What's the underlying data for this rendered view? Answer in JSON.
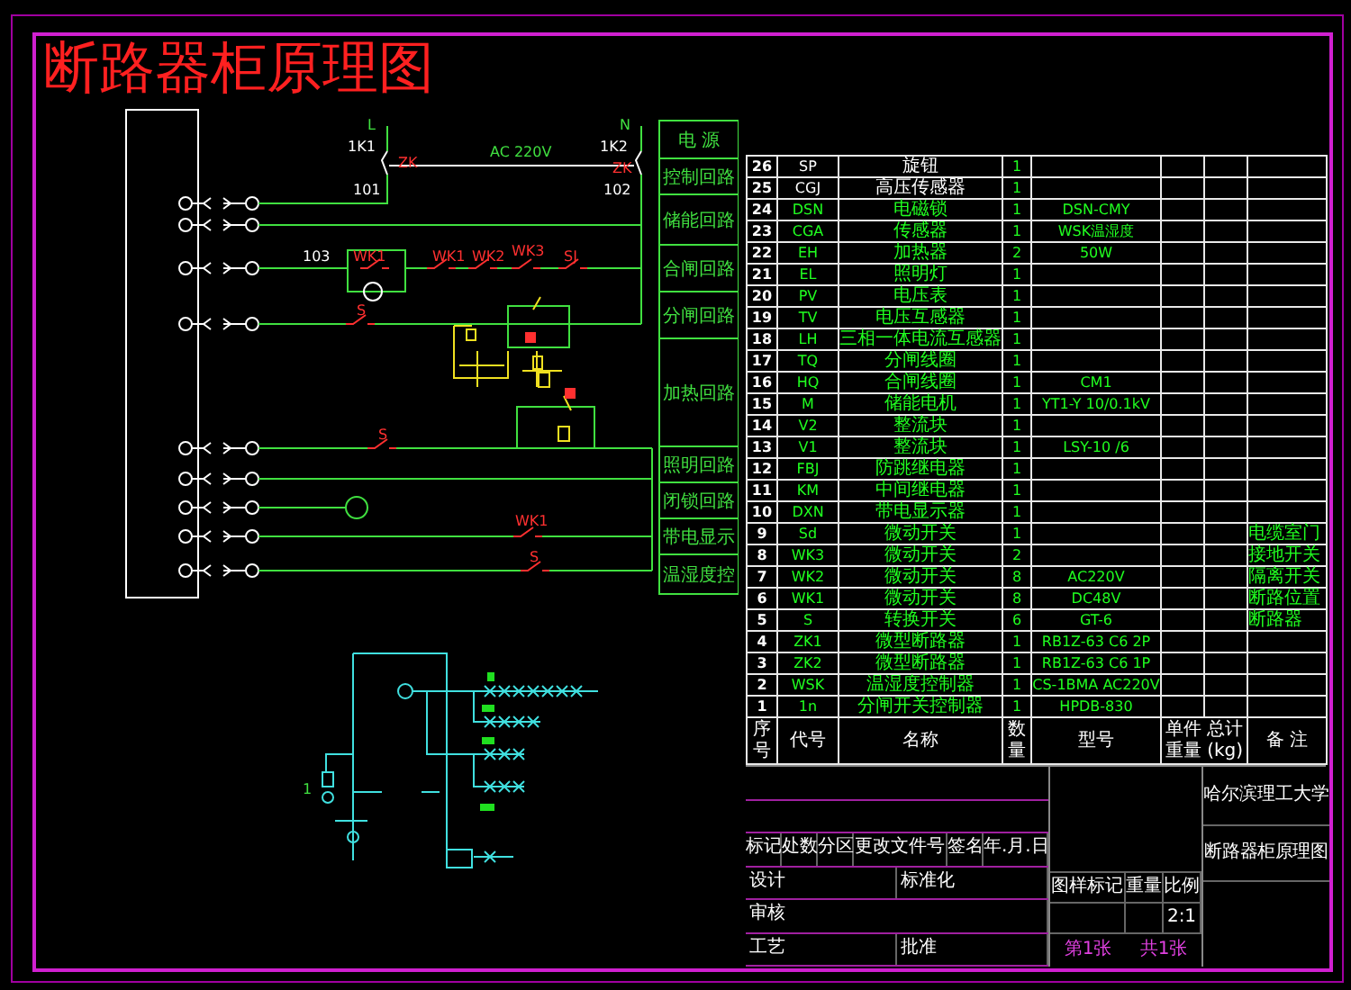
{
  "title": "断路器柜原理图",
  "schematic": {
    "labels": [
      {
        "text": "L",
        "color": "#40e040"
      },
      {
        "text": "N",
        "color": "#40e040"
      },
      {
        "text": "1K1",
        "color": "#ffffff"
      },
      {
        "text": "AC 220V",
        "color": "#40e040"
      },
      {
        "text": "1K2",
        "color": "#ffffff"
      },
      {
        "text": "ZK",
        "color": "#ff3030"
      },
      {
        "text": "ZK",
        "color": "#ff3030"
      },
      {
        "text": "101",
        "color": "#ffffff"
      },
      {
        "text": "102",
        "color": "#ffffff"
      },
      {
        "text": "103",
        "color": "#ffffff"
      },
      {
        "text": "WK1",
        "color": "#ff3030"
      },
      {
        "text": "WK1",
        "color": "#ff3030"
      },
      {
        "text": "WK2",
        "color": "#ff3030"
      },
      {
        "text": "WK3",
        "color": "#ff3030"
      },
      {
        "text": "SJ",
        "color": "#ff3030"
      },
      {
        "text": "S",
        "color": "#ff3030"
      },
      {
        "text": "S",
        "color": "#ff3030"
      },
      {
        "text": "WK1",
        "color": "#ff3030"
      },
      {
        "text": "S",
        "color": "#ff3030"
      },
      {
        "text": "1",
        "color": "#40e040"
      }
    ],
    "circuit_boxes": [
      "电 源",
      "控制回路",
      "储能回路",
      "合闸回路",
      "分闸回路",
      "加热回路",
      "照明回路",
      "闭锁回路",
      "带电显示",
      "温湿度控"
    ]
  },
  "parts_table": {
    "columns": [
      "序号",
      "代号",
      "名称",
      "数量",
      "型号"
    ],
    "weight_header": [
      "单件 总计",
      "重量 (kg)"
    ],
    "remark_header": "备 注",
    "rows": [
      {
        "no": "26",
        "code": "SP",
        "name": "旋钮",
        "qty": "1",
        "color": "#ffffff"
      },
      {
        "no": "25",
        "code": "CGJ",
        "name": "高压传感器",
        "qty": "1",
        "color": "#ffffff"
      },
      {
        "no": "24",
        "code": "DSN",
        "name": "电磁锁",
        "qty": "1",
        "model": "DSN-CMY",
        "color": "#20ff20"
      },
      {
        "no": "23",
        "code": "CGA",
        "name": "传感器",
        "qty": "1",
        "model": "WSK温湿度",
        "color": "#20ff20"
      },
      {
        "no": "22",
        "code": "EH",
        "name": "加热器",
        "qty": "2",
        "model": "50W",
        "color": "#20ff20"
      },
      {
        "no": "21",
        "code": "EL",
        "name": "照明灯",
        "qty": "1",
        "color": "#20ff20"
      },
      {
        "no": "20",
        "code": "PV",
        "name": "电压表",
        "qty": "1",
        "color": "#20ff20"
      },
      {
        "no": "19",
        "code": "TV",
        "name": "电压互感器",
        "qty": "1",
        "color": "#20ff20"
      },
      {
        "no": "18",
        "code": "LH",
        "name": "三相一体电流互感器",
        "qty": "1",
        "color": "#20ff20"
      },
      {
        "no": "17",
        "code": "TQ",
        "name": "分闸线圈",
        "qty": "1",
        "color": "#20ff20"
      },
      {
        "no": "16",
        "code": "HQ",
        "name": "合闸线圈",
        "qty": "1",
        "model": "CM1",
        "color": "#20ff20"
      },
      {
        "no": "15",
        "code": "M",
        "name": "储能电机",
        "qty": "1",
        "model": "YT1-Y 10/0.1kV",
        "color": "#20ff20"
      },
      {
        "no": "14",
        "code": "V2",
        "name": "整流块",
        "qty": "1",
        "color": "#20ff20"
      },
      {
        "no": "13",
        "code": "V1",
        "name": "整流块",
        "qty": "1",
        "model": "LSY-10 /6",
        "color": "#20ff20"
      },
      {
        "no": "12",
        "code": "FBJ",
        "name": "防跳继电器",
        "qty": "1",
        "color": "#20ff20"
      },
      {
        "no": "11",
        "code": "KM",
        "name": "中间继电器",
        "qty": "1",
        "color": "#20ff20"
      },
      {
        "no": "10",
        "code": "DXN",
        "name": "带电显示器",
        "qty": "1",
        "color": "#20ff20"
      },
      {
        "no": "9",
        "code": "Sd",
        "name": "微动开关",
        "qty": "1",
        "remark": "电缆室门",
        "color": "#20ff20"
      },
      {
        "no": "8",
        "code": "WK3",
        "name": "微动开关",
        "qty": "2",
        "remark": "接地开关",
        "color": "#20ff20"
      },
      {
        "no": "7",
        "code": "WK2",
        "name": "微动开关",
        "qty": "8",
        "model": "AC220V",
        "remark": "隔离开关",
        "color": "#20ff20"
      },
      {
        "no": "6",
        "code": "WK1",
        "name": "微动开关",
        "qty": "8",
        "model": "DC48V",
        "remark": "断路位置",
        "color": "#20ff20"
      },
      {
        "no": "5",
        "code": "S",
        "name": "转换开关",
        "qty": "6",
        "model": "GT-6",
        "remark": "断路器",
        "color": "#20ff20"
      },
      {
        "no": "4",
        "code": "ZK1",
        "name": "微型断路器",
        "qty": "1",
        "model": "RB1Z-63 C6 2P",
        "color": "#20ff20"
      },
      {
        "no": "3",
        "code": "ZK2",
        "name": "微型断路器",
        "qty": "1",
        "model": "RB1Z-63 C6 1P",
        "color": "#20ff20"
      },
      {
        "no": "2",
        "code": "WSK",
        "name": "温湿度控制器",
        "qty": "1",
        "model": "CS-1BMA AC220V",
        "color": "#20ff20"
      },
      {
        "no": "1",
        "code": "1n",
        "name": "分闸开关控制器",
        "qty": "1",
        "model": "HPDB-830",
        "color": "#20ff20"
      }
    ]
  },
  "title_block": {
    "revision_headers": [
      "标记",
      "处数",
      "分区",
      "更改文件号",
      "签名",
      "年.月.日"
    ],
    "roles": [
      "设计",
      "标准化",
      "审核",
      "工艺",
      "批准"
    ],
    "info_headers": [
      "图样标记",
      "重量",
      "比例"
    ],
    "scale": "2:1",
    "sheet": "第1张",
    "sheets_total": "共1张",
    "school": "哈尔滨理工大学",
    "drawing_name": "断路器柜原理图"
  }
}
